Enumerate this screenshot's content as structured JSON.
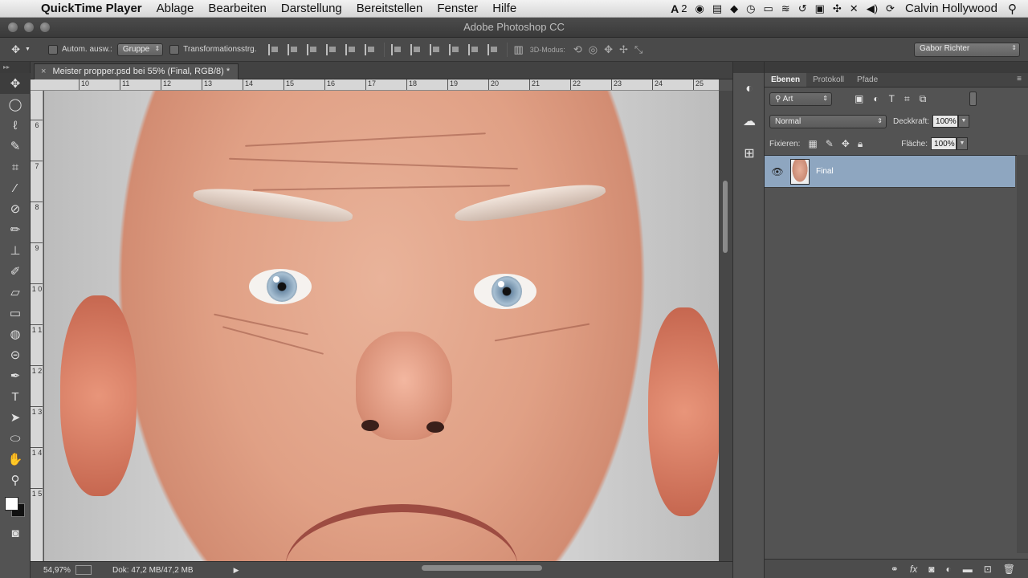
{
  "menubar": {
    "apple": "",
    "app": "QuickTime Player",
    "items": [
      "Ablage",
      "Bearbeiten",
      "Darstellung",
      "Bereitstellen",
      "Fenster",
      "Hilfe"
    ],
    "adobe_count": "2",
    "user": "Calvin Hollywood"
  },
  "window": {
    "title": "Adobe Photoshop CC"
  },
  "options": {
    "auto_select_label": "Autom. ausw.:",
    "auto_select_value": "Gruppe",
    "transform_label": "Transformationsstrg.",
    "mode3d_label": "3D-Modus:",
    "workspace": "Gabor Richter"
  },
  "document": {
    "tab_title": "Meister propper.psd bei 55% (Final, RGB/8) *"
  },
  "hruler_ticks": [
    "10",
    "11",
    "12",
    "13",
    "14",
    "15",
    "16",
    "17",
    "18",
    "19",
    "20",
    "21",
    "22",
    "23",
    "24",
    "25"
  ],
  "vruler_ticks": [
    "6",
    "7",
    "8",
    "9",
    "1 0",
    "1 1",
    "1 2",
    "1 3",
    "1 4",
    "1 5"
  ],
  "status": {
    "zoom": "54,97%",
    "doc": "Dok: 47,2 MB/47,2 MB"
  },
  "layers_panel": {
    "tabs": [
      "Ebenen",
      "Protokoll",
      "Pfade"
    ],
    "filter": "Art",
    "blend_mode": "Normal",
    "opacity_label": "Deckkraft:",
    "opacity_value": "100%",
    "lock_label": "Fixieren:",
    "fill_label": "Fläche:",
    "fill_value": "100%",
    "layer_name": "Final"
  }
}
